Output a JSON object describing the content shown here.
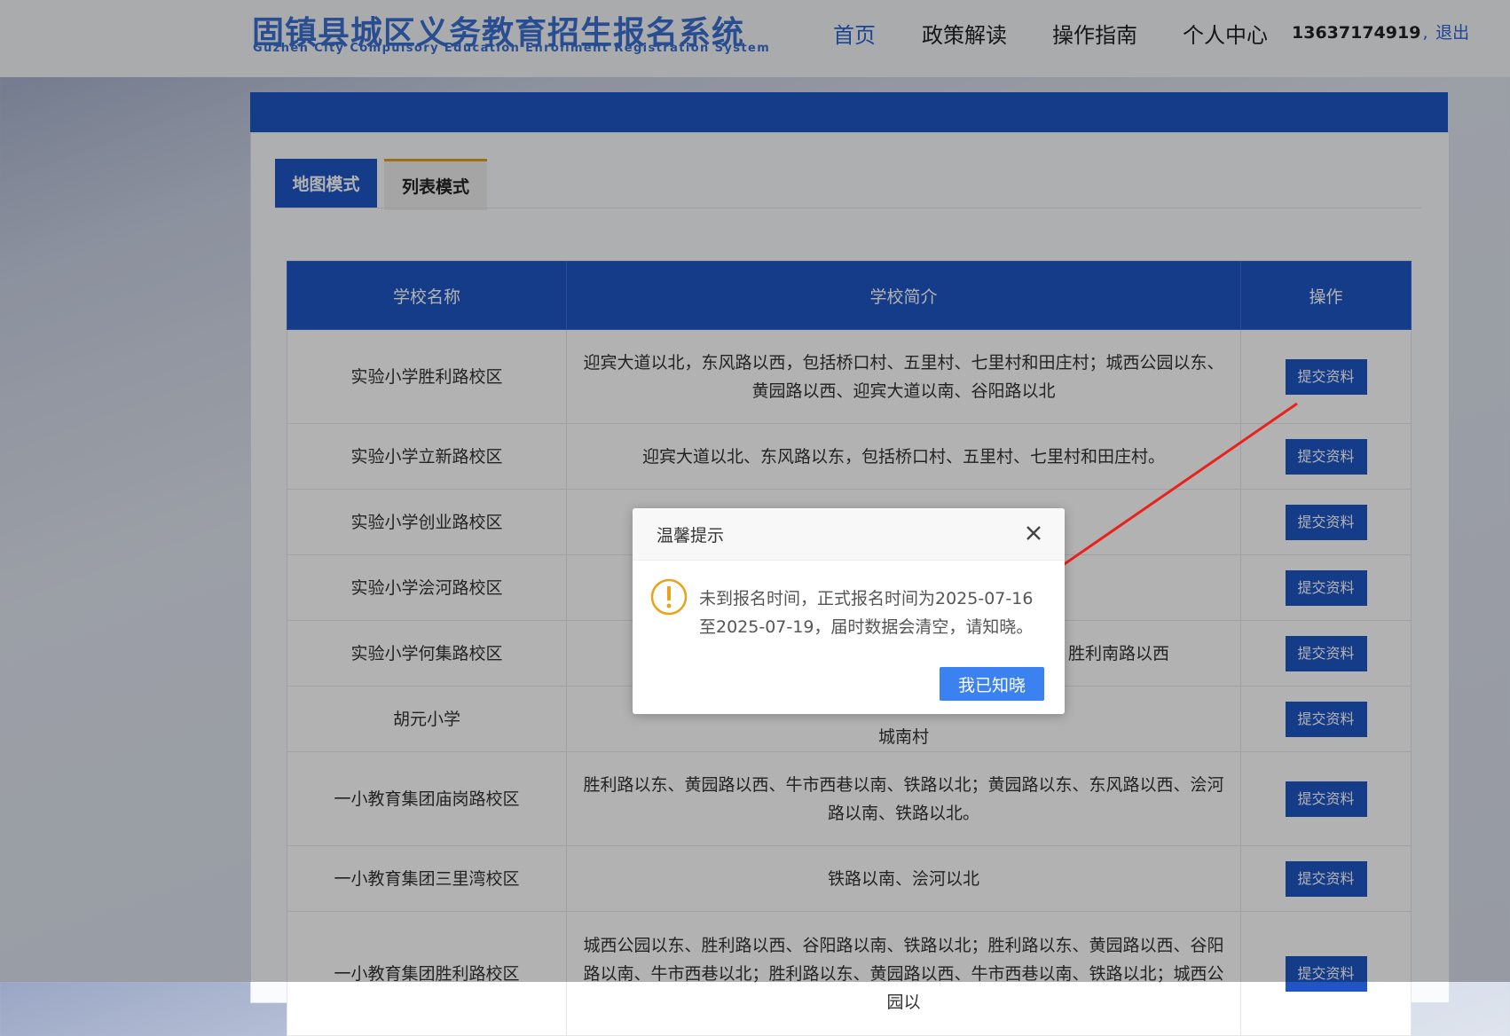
{
  "header": {
    "title": "固镇县城区义务教育招生报名系统",
    "subtitle": "Guzhen City Compulsory Education Enrollment Registration System",
    "nav": [
      "首页",
      "政策解读",
      "操作指南",
      "个人中心"
    ],
    "user_phone": "13637174919",
    "separator": ",",
    "logout": "退出"
  },
  "tabs": {
    "map": "地图模式",
    "list": "列表模式"
  },
  "table": {
    "headers": [
      "学校名称",
      "学校简介",
      "操作"
    ],
    "action_label": "提交资料",
    "rows": [
      {
        "name": "实验小学胜利路校区",
        "desc": "迎宾大道以北，东风路以西，包括桥口村、五里村、七里村和田庄村；城西公园以东、黄园路以西、迎宾大道以南、谷阳路以北"
      },
      {
        "name": "实验小学立新路校区",
        "desc": "迎宾大道以北、东风路以东，包括桥口村、五里村、七里村和田庄村。"
      },
      {
        "name": "实验小学创业路校区",
        "desc": ""
      },
      {
        "name": "实验小学浍河路校区",
        "desc": ""
      },
      {
        "name": "实验小学何集路校区",
        "desc": "胜利南路以西"
      },
      {
        "name": "胡元小学",
        "desc": "城南村"
      },
      {
        "name": "一小教育集团庙岗路校区",
        "desc": "胜利路以东、黄园路以西、牛市西巷以南、铁路以北；黄园路以东、东风路以西、浍河路以南、铁路以北。"
      },
      {
        "name": "一小教育集团三里湾校区",
        "desc": "铁路以南、浍河以北"
      },
      {
        "name": "一小教育集团胜利路校区",
        "desc": "城西公园以东、胜利路以西、谷阳路以南、铁路以北；胜利路以东、黄园路以西、谷阳路以南、牛市西巷以北；胜利路以东、黄园路以西、牛市西巷以南、铁路以北；城西公园以"
      }
    ]
  },
  "modal": {
    "title": "温馨提示",
    "message": "未到报名时间，正式报名时间为2025-07-16至2025-07-19，届时数据会清空，请知晓。",
    "confirm": "我已知晓",
    "icon": "warning-icon"
  },
  "colors": {
    "primary": "#1f56c4",
    "link": "#2d63d6",
    "confirm_button": "#3b82f0",
    "warning": "#e8a317",
    "annotation_arrow": "#e8231c"
  }
}
